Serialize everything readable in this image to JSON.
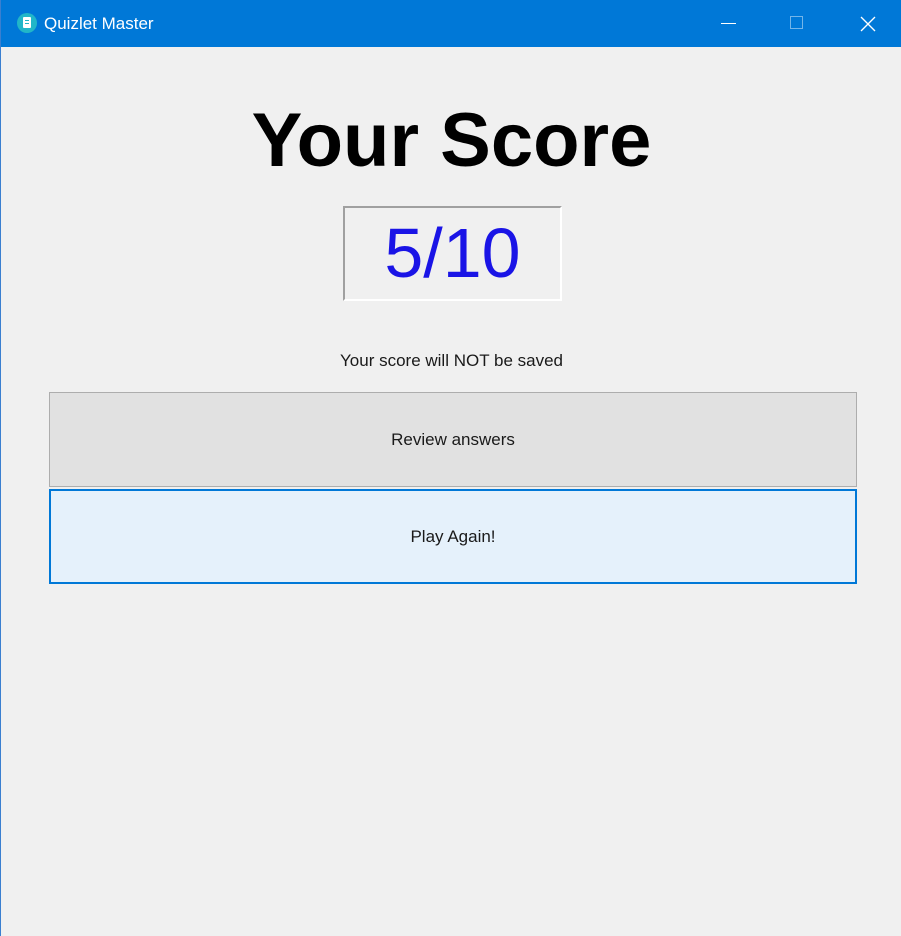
{
  "window": {
    "title": "Quizlet Master"
  },
  "score_screen": {
    "heading": "Your Score",
    "score": "5/10",
    "save_note": "Your score will NOT be saved",
    "review_label": "Review answers",
    "play_again_label": "Play Again!"
  },
  "colors": {
    "titlebar": "#0078d7",
    "score_text": "#1a14e6",
    "focused_button_border": "#0078d7"
  },
  "icons": {
    "app": "quizlet-app-icon",
    "minimize": "minimize-icon",
    "maximize": "maximize-icon",
    "close": "close-icon"
  }
}
